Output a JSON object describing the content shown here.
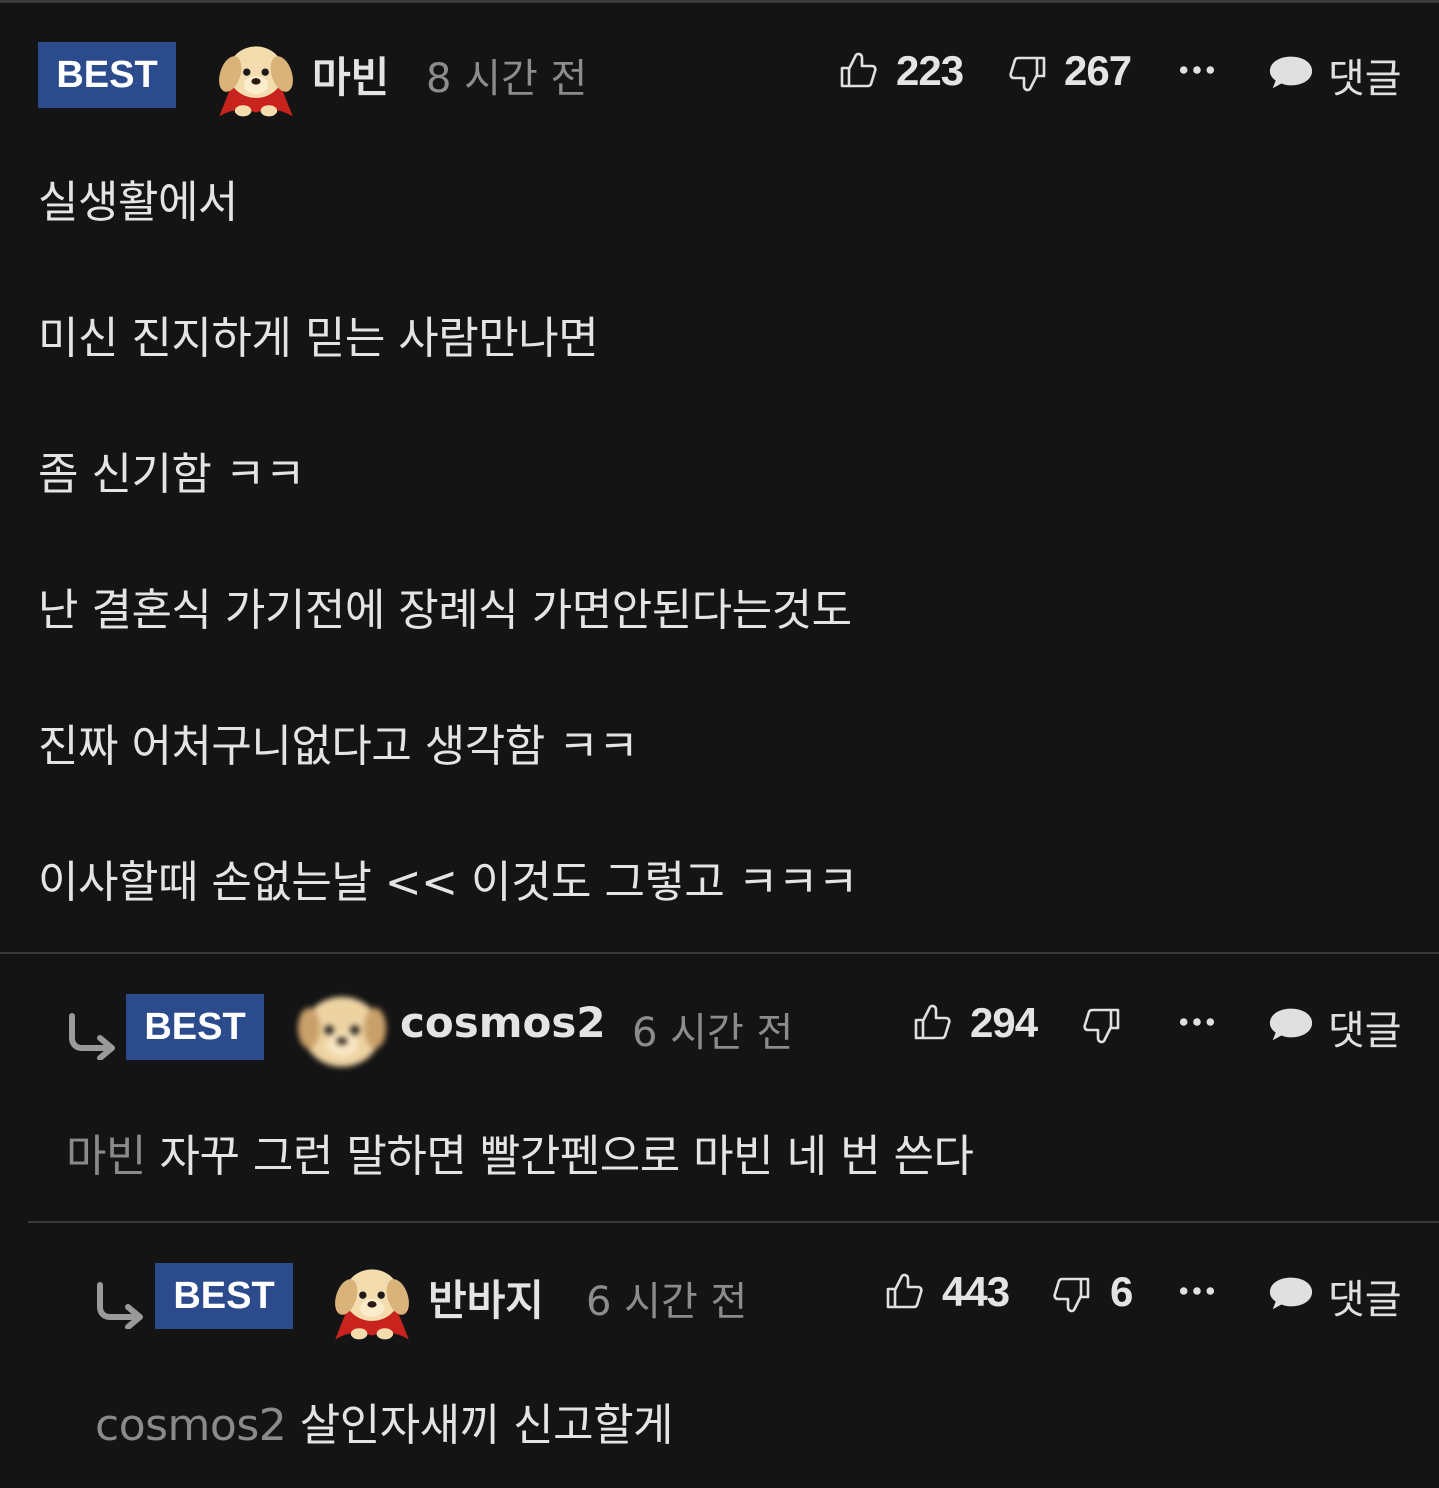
{
  "colors": {
    "background": "#141414",
    "best_badge": "#2b4b8c",
    "divider": "#3a3a3a",
    "muted_text": "#8c8c8c"
  },
  "icons": [
    "reply-arrow-icon",
    "thumbs-up-icon",
    "thumbs-down-icon",
    "more-icon",
    "speech-bubble-icon"
  ],
  "comments": [
    {
      "badge": "BEST",
      "username": "마빈",
      "time": "8 시간 전",
      "likes": "223",
      "dislikes": "267",
      "reply_label": "댓글",
      "avatar": "puppy-with-red-cape",
      "lines": [
        "실생활에서",
        "미신 진지하게 믿는 사람만나면",
        "좀 신기함 ㅋㅋ",
        "난 결혼식 가기전에 장례식 가면안된다는것도",
        "진짜 어처구니없다고 생각함 ㅋㅋ",
        "이사할때 손없는날 << 이것도 그렇고 ㅋㅋㅋ"
      ]
    },
    {
      "badge": "BEST",
      "username": "cosmos2",
      "time": "6 시간 전",
      "likes": "294",
      "dislikes": "",
      "reply_label": "댓글",
      "avatar": "puppy-face-blurred",
      "mention": "마빈",
      "text": "자꾸 그런 말하면 빨간펜으로 마빈 네 번 쓴다"
    },
    {
      "badge": "BEST",
      "username": "반바지",
      "time": "6 시간 전",
      "likes": "443",
      "dislikes": "6",
      "reply_label": "댓글",
      "avatar": "puppy-with-red-cape",
      "mention": "cosmos2",
      "text": "살인자새끼 신고할게"
    }
  ]
}
